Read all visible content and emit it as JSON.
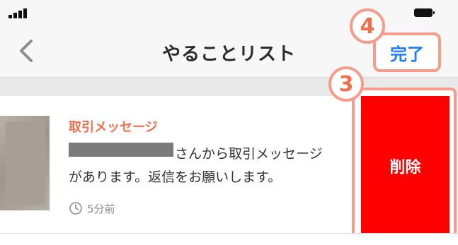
{
  "status_bar": {
    "signal_icon": "signal-bars-icon",
    "battery_icon": "battery-icon"
  },
  "nav": {
    "back_icon": "chevron-left-icon",
    "title": "やることリスト",
    "done_label": "完了"
  },
  "list": {
    "items": [
      {
        "title": "取引メッセージ",
        "body_line1": "さんから取引メッセージ",
        "body_line2": "があります。返信をお願いします。",
        "time": "5分前",
        "time_icon": "clock-icon",
        "delete_label": "削除"
      }
    ]
  },
  "annotations": {
    "step_done": "4",
    "step_delete": "3"
  },
  "colors": {
    "accent_orange": "#f26f4e",
    "highlight_border": "#f59c8a",
    "link_blue": "#1a7cf2",
    "delete_red": "#ff0000"
  }
}
